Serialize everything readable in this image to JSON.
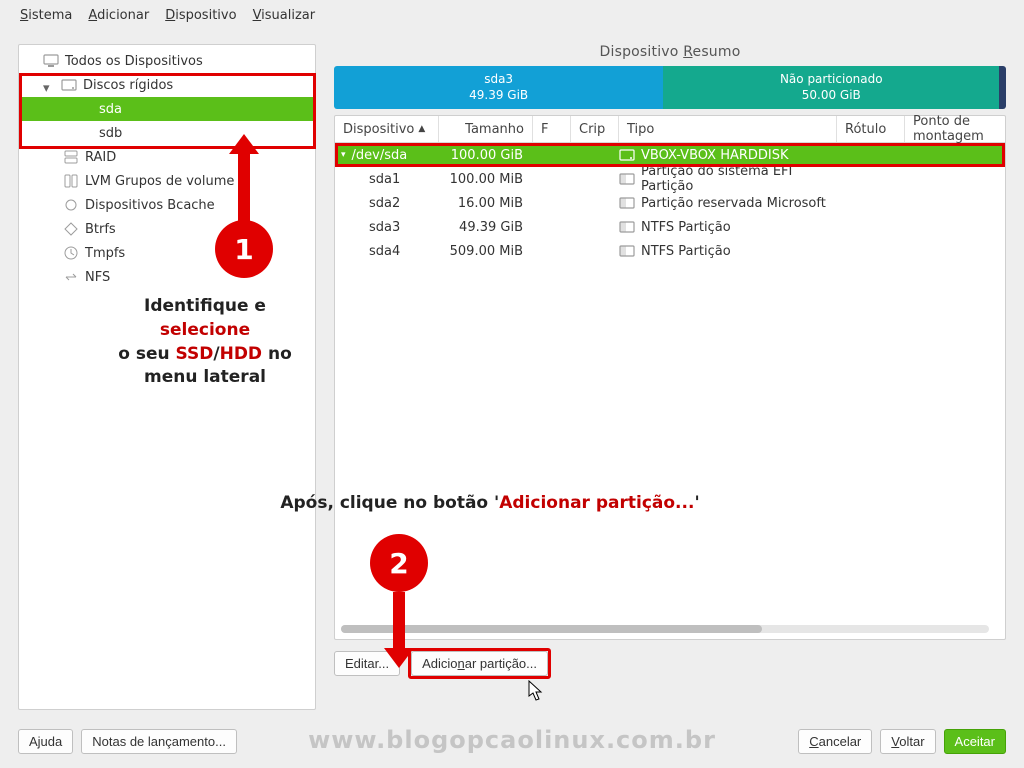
{
  "menu": {
    "sistema": "Sistema",
    "adicionar": "Adicionar",
    "dispositivo": "Dispositivo",
    "visualizar": "Visualizar"
  },
  "sidebar": {
    "all_devices": "Todos os Dispositivos",
    "hard_disks": "Discos rígidos",
    "disks": [
      "sda",
      "sdb"
    ],
    "raid": "RAID",
    "lvm": "LVM Grupos de volume",
    "bcache": "Dispositivos Bcache",
    "btrfs": "Btrfs",
    "tmpfs": "Tmpfs",
    "nfs": "NFS"
  },
  "right": {
    "header": "Dispositivo Resumo",
    "map": {
      "sda3_label": "sda3",
      "sda3_size": "49.39 GiB",
      "free_label": "Não particionado",
      "free_size": "50.00 GiB"
    },
    "columns": {
      "dev": "Dispositivo",
      "size": "Tamanho",
      "f": "F",
      "crip": "Crip",
      "tipo": "Tipo",
      "rot": "Rótulo",
      "mnt": "Ponto de montagem"
    },
    "rows": [
      {
        "dev": "/dev/sda",
        "size": "100.00 GiB",
        "tipo": "VBOX-VBOX HARDDISK",
        "selected": true,
        "indent": 0
      },
      {
        "dev": "sda1",
        "size": "100.00 MiB",
        "tipo": "Partição do sistema EFI Partição",
        "indent": 1
      },
      {
        "dev": "sda2",
        "size": "16.00 MiB",
        "tipo": "Partição reservada Microsoft",
        "indent": 1
      },
      {
        "dev": "sda3",
        "size": "49.39 GiB",
        "tipo": "NTFS Partição",
        "indent": 1
      },
      {
        "dev": "sda4",
        "size": "509.00 MiB",
        "tipo": "NTFS Partição",
        "indent": 1
      }
    ],
    "actions": {
      "edit": "Editar...",
      "add": "Adicionar partição..."
    }
  },
  "footer": {
    "help": "Ajuda",
    "release": "Notas de lançamento...",
    "cancel": "Cancelar",
    "back": "Voltar",
    "accept": "Aceitar"
  },
  "annotations": {
    "one": "1",
    "two": "2",
    "line1a": "Identifique e ",
    "line1b": "selecione",
    "line2a": " o seu ",
    "line2b": "SSD",
    "line2c": "/",
    "line2d": "HDD",
    "line2e": " no",
    "line3": "menu lateral",
    "after1": "Após, clique no botão '",
    "after2": "Adicionar partição...",
    "after3": "'"
  },
  "watermark": "www.blogopcaolinux.com.br"
}
